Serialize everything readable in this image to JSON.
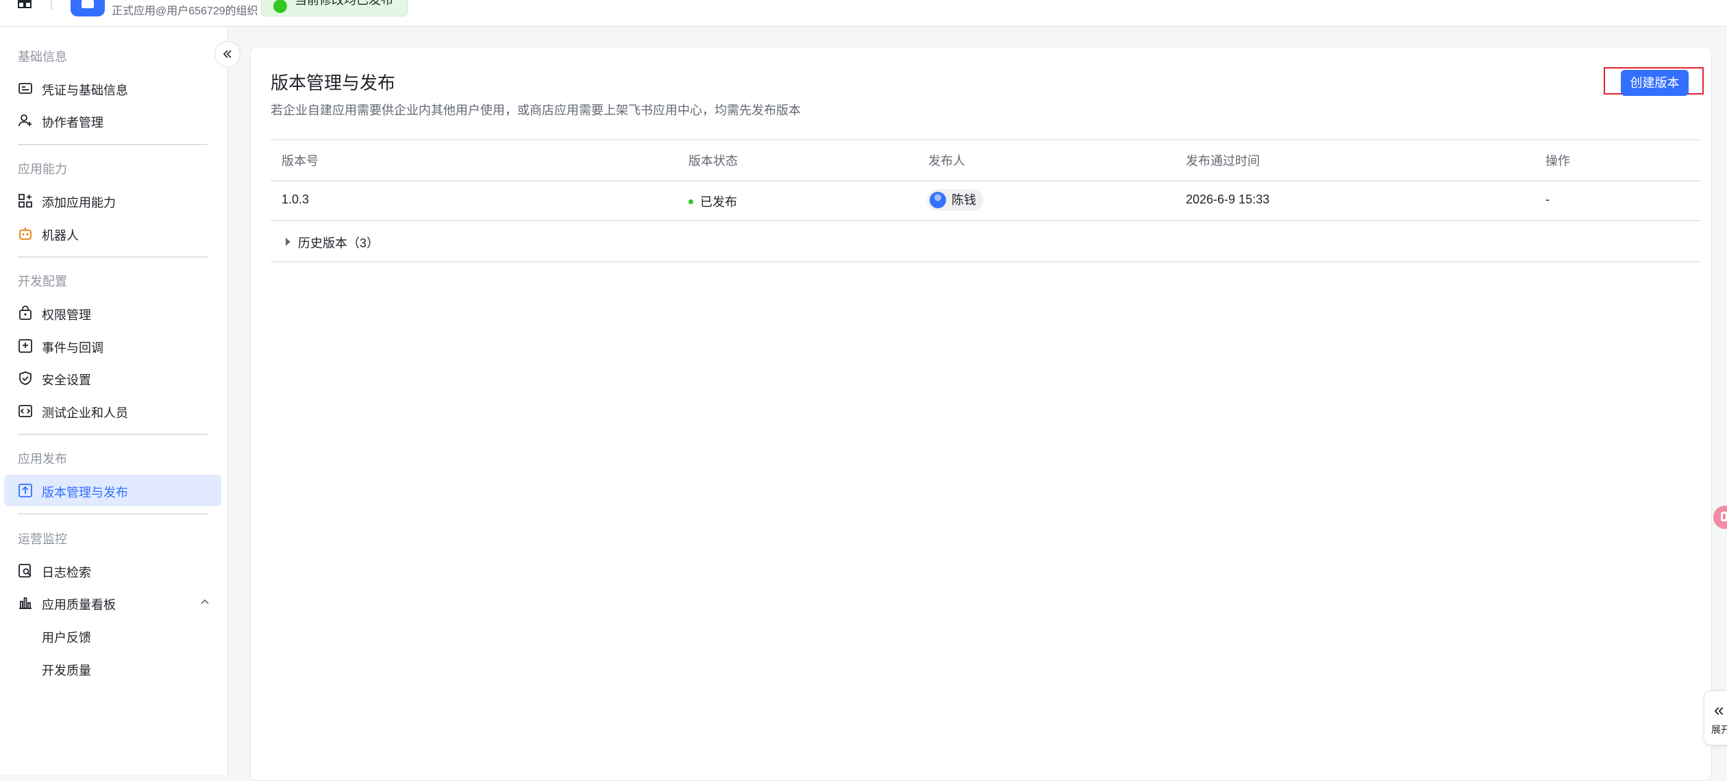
{
  "topbar": {
    "app_subtitle": "正式应用@用户656729的组织",
    "status_text": "当前修改均已发布"
  },
  "sidebar": {
    "groups": [
      {
        "title": "基础信息",
        "items": [
          {
            "label": "凭证与基础信息",
            "icon": "credential-icon"
          },
          {
            "label": "协作者管理",
            "icon": "user-add-icon"
          }
        ]
      },
      {
        "title": "应用能力",
        "items": [
          {
            "label": "添加应用能力",
            "icon": "apps-add-icon"
          },
          {
            "label": "机器人",
            "icon": "robot-icon"
          }
        ]
      },
      {
        "title": "开发配置",
        "items": [
          {
            "label": "权限管理",
            "icon": "lock-bag-icon"
          },
          {
            "label": "事件与回调",
            "icon": "event-icon"
          },
          {
            "label": "安全设置",
            "icon": "shield-icon"
          },
          {
            "label": "测试企业和人员",
            "icon": "code-box-icon"
          }
        ]
      },
      {
        "title": "应用发布",
        "items": [
          {
            "label": "版本管理与发布",
            "icon": "upload-box-icon",
            "active": true
          }
        ]
      },
      {
        "title": "运营监控",
        "items": [
          {
            "label": "日志检索",
            "icon": "log-search-icon"
          },
          {
            "label": "应用质量看板",
            "icon": "bar-chart-icon",
            "expanded": true
          },
          {
            "label": "用户反馈"
          },
          {
            "label": "开发质量"
          }
        ]
      }
    ]
  },
  "main": {
    "title": "版本管理与发布",
    "description": "若企业自建应用需要供企业内其他用户使用，或商店应用需要上架飞书应用中心，均需先发布版本",
    "create_button": "创建版本",
    "table": {
      "headers": [
        "版本号",
        "版本状态",
        "发布人",
        "发布通过时间",
        "操作"
      ],
      "rows": [
        {
          "version": "1.0.3",
          "status": "已发布",
          "publisher": "陈钱",
          "time": "2026-6-9 15:33",
          "action": "-"
        }
      ],
      "history_label": "历史版本（3）"
    }
  },
  "right_tab": {
    "label": "展开"
  },
  "colors": {
    "accent": "#3370ff",
    "success": "#34c724",
    "highlight_border": "#e6232f"
  }
}
